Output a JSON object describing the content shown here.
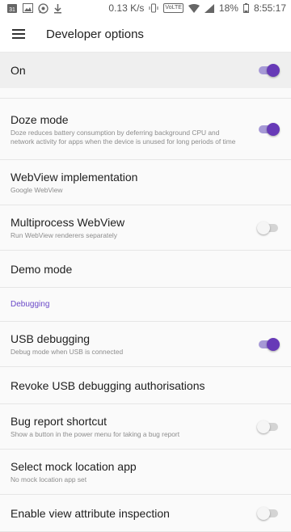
{
  "status_bar": {
    "date_badge": "31",
    "speed": "0.13 K/s",
    "volte": "VoLTE",
    "battery": "18%",
    "time": "8:55:17"
  },
  "app_bar": {
    "title": "Developer options",
    "menu_icon": "hamburger-menu-icon"
  },
  "master": {
    "label": "On",
    "enabled": true
  },
  "items": [
    {
      "title": "Doze mode",
      "subtitle": "Doze reduces battery consumption by deferring background CPU and network activity for apps when the device is unused for long periods of time",
      "toggle": "on"
    },
    {
      "title": "WebView implementation",
      "subtitle": "Google WebView"
    },
    {
      "title": "Multiprocess WebView",
      "subtitle": "Run WebView renderers separately",
      "toggle": "off"
    },
    {
      "title": "Demo mode"
    }
  ],
  "section": {
    "header": "Debugging"
  },
  "debug_items": [
    {
      "title": "USB debugging",
      "subtitle": "Debug mode when USB is connected",
      "toggle": "on"
    },
    {
      "title": "Revoke USB debugging authorisations"
    },
    {
      "title": "Bug report shortcut",
      "subtitle": "Show a button in the power menu for taking a bug report",
      "toggle": "off"
    },
    {
      "title": "Select mock location app",
      "subtitle": "No mock location app set"
    },
    {
      "title": "Enable view attribute inspection",
      "toggle": "off"
    }
  ],
  "colors": {
    "accent": "#673ab7",
    "accent_track": "#a699d6",
    "section_header": "#6a49c8"
  }
}
